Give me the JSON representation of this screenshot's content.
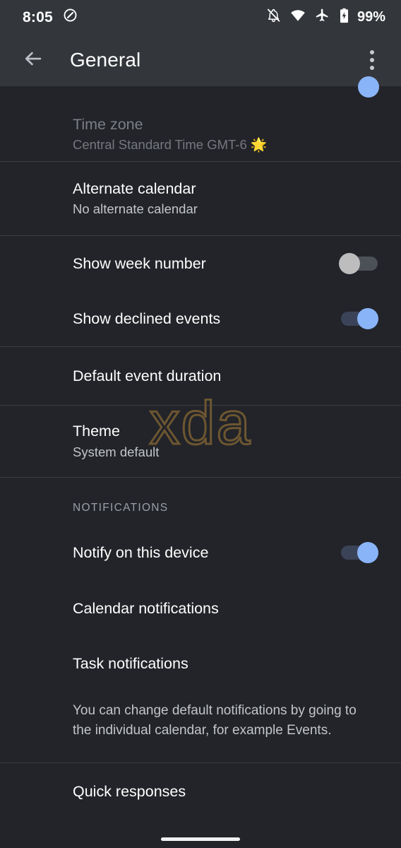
{
  "status_bar": {
    "time": "8:05",
    "rotation_icon": "rotation-locked-icon",
    "icons": [
      "notifications-silenced-icon",
      "wifi-icon",
      "airplane-mode-icon",
      "battery-charging-icon"
    ],
    "battery_percent": "99%"
  },
  "app_bar": {
    "back_icon": "back-arrow-icon",
    "title": "General",
    "overflow_icon": "overflow-menu-icon"
  },
  "colors": {
    "background": "#222429",
    "app_bar": "#33363b",
    "divider": "#3a3d42",
    "accent_on": "#8ab4f8",
    "track_on": "#3b4358",
    "thumb_off": "#bdbdbd",
    "track_off": "#4c5057",
    "watermark": "#6d5631"
  },
  "settings": {
    "time_zone": {
      "title": "Time zone",
      "subtitle": "Central Standard Time  GMT-6",
      "subtitle_emoji": "☀",
      "disabled": true
    },
    "alternate_calendar": {
      "title": "Alternate calendar",
      "subtitle": "No alternate calendar"
    },
    "show_week_number": {
      "title": "Show week number",
      "toggle": "off"
    },
    "show_declined_events": {
      "title": "Show declined events",
      "toggle": "on"
    },
    "default_event_duration": {
      "title": "Default event duration"
    },
    "theme": {
      "title": "Theme",
      "subtitle": "System default"
    }
  },
  "notifications_section": {
    "header": "NOTIFICATIONS",
    "notify_on_this_device": {
      "title": "Notify on this device",
      "toggle": "on"
    },
    "calendar_notifications": {
      "title": "Calendar notifications"
    },
    "task_notifications": {
      "title": "Task notifications"
    },
    "note": "You can change default notifications by going to the individual calendar, for example Events."
  },
  "quick_responses": {
    "title": "Quick responses"
  },
  "watermark": {
    "text": "xda"
  }
}
